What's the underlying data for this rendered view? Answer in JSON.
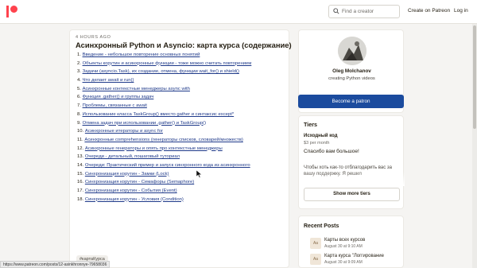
{
  "header": {
    "logo": "patreon-logo-icon",
    "search_placeholder": "Find a creator",
    "create_link": "Create on Patreon",
    "login_link": "Log in"
  },
  "post": {
    "time_ago": "4 HOURS AGO",
    "title": "Асинхронный Python и Asyncio: карта курса (содержание)",
    "items": [
      {
        "num": "1.",
        "text": "Введение - небольшое повторение основных понятий"
      },
      {
        "num": "2.",
        "text": "Объекты корутин и асинхронные функции - тоже можно считать повторением"
      },
      {
        "num": "3.",
        "text": "Задачи (asyncio.Task), их создание, отмена, функции wait_for() и shield()"
      },
      {
        "num": "4.",
        "text": "Что делает await и run()"
      },
      {
        "num": "5.",
        "text": "Асинхронные контекстные менеджеры async with"
      },
      {
        "num": "6.",
        "text": "Функция .gather() и группы задач"
      },
      {
        "num": "7.",
        "text": "Проблемы, связанные с await"
      },
      {
        "num": "8.",
        "text": "Использование класса TaskGroup() вместо gather и синтаксис except*"
      },
      {
        "num": "9.",
        "text": "Отмена задач при использовании .gather() и TaskGroup()"
      },
      {
        "num": "10.",
        "text": "Асинхронные итераторы и async for"
      },
      {
        "num": "11.",
        "text": "Асинхронные comprehensions (генераторы списков, словарей/множеств)"
      },
      {
        "num": "12.",
        "text": "Асинхронные генераторы и опять про контекстные менеджеры"
      },
      {
        "num": "13.",
        "text": "Очереди - детальный, пошаговый туториал"
      },
      {
        "num": "14.",
        "text": "Очереди: Практический пример и запуск синхронного кода из асинхронного"
      },
      {
        "num": "15.",
        "text": "Синхронизация корутин - Замки (Lock)"
      },
      {
        "num": "16.",
        "text": "Синхронизация корутин - Семафоры (Semaphore)"
      },
      {
        "num": "17.",
        "text": "Синхронизация корутин - События (Event)"
      },
      {
        "num": "18.",
        "text": "Синхронизация корутин - Условия (Condition)"
      }
    ],
    "tag": "#картаКурса"
  },
  "status_bar": {
    "url": "https://www.patreon.com/posts/12-asinkhronnye-79658036"
  },
  "creator": {
    "name": "Oleg Molchanov",
    "subtitle": "creating Python videos",
    "become_patron": "Become a patron"
  },
  "tiers": {
    "heading": "Tiers",
    "tier_name": "Исходный код",
    "tier_price": "$3 per month",
    "tier_thanks": "Спасибо вам большое!",
    "tier_desc": "Чтобы хоть как-то отблагодарить вас за вашу поддержку. Я решил",
    "more_button": "Show more tiers"
  },
  "recent_posts": {
    "heading": "Recent Posts",
    "items": [
      {
        "thumb": "Aa",
        "title": "Карты всех курсов",
        "date": "August 30 at 9:10 AM"
      },
      {
        "thumb": "Aa",
        "title": "Карта курса \"Логгирование",
        "date": "August 30 at 9:09 AM"
      }
    ]
  },
  "colors": {
    "brand": "#ff424d",
    "primary_button": "#1b4b9e",
    "link": "#1f3a8a",
    "background": "#f5f4f2"
  }
}
